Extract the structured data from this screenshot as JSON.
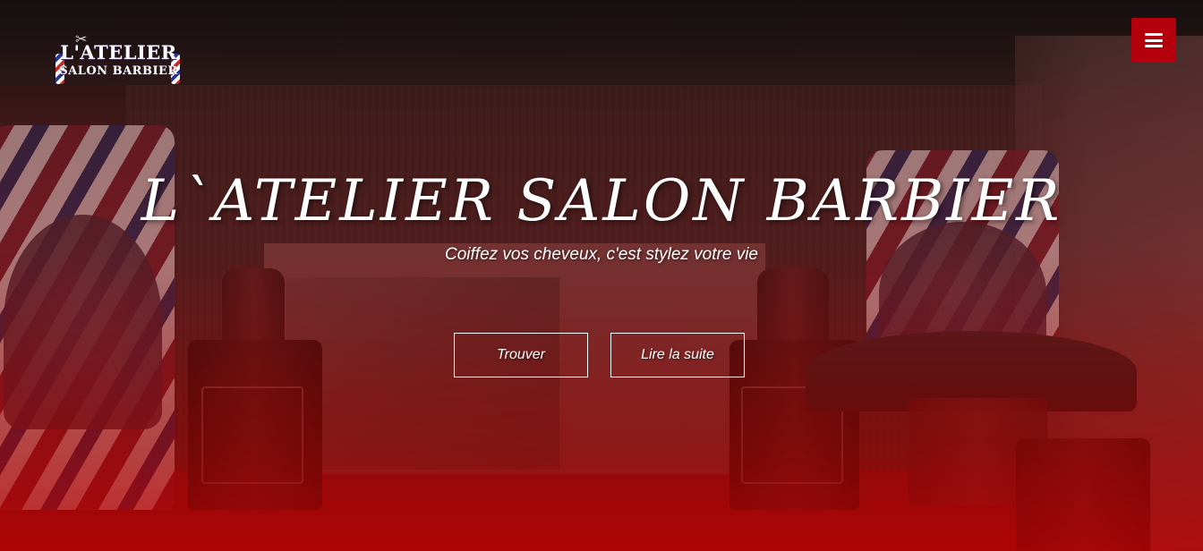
{
  "logo": {
    "line1": "L'ATELIER",
    "line2": "SALON BARBIER",
    "icon": "scissors-icon"
  },
  "menu": {
    "icon": "hamburger-menu-icon",
    "color": "#b4000c"
  },
  "hero": {
    "title": "L`ATELIER SALON BARBIER",
    "subtitle": "Coiffez vos cheveux, c'est stylez votre vie",
    "buttons": {
      "find_label": "Trouver",
      "more_label": "Lire la suite"
    }
  },
  "theme": {
    "accent": "#b4000c",
    "overlay": "#c00000"
  }
}
